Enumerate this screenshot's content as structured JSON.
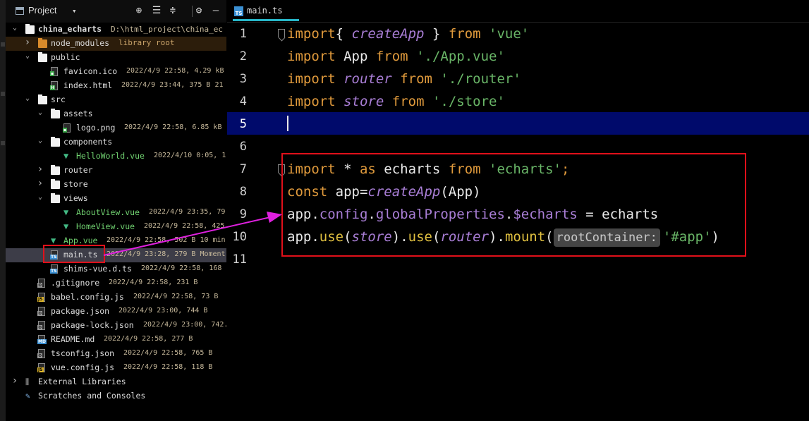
{
  "project_panel": {
    "title": "Project",
    "dropdown_glyph": "▾",
    "toolbar": [
      "target-icon",
      "expand-all-icon",
      "collapse-all-icon",
      "gear-icon",
      "hide-icon"
    ],
    "tree": [
      {
        "depth": 0,
        "chevron": "down",
        "kind": "folder",
        "name": "china_echarts",
        "meta": "D:\\html_project\\china_ec"
      },
      {
        "depth": 1,
        "chevron": "right",
        "kind": "folder-orange",
        "name": "node_modules",
        "meta": "library root"
      },
      {
        "depth": 1,
        "chevron": "down",
        "kind": "folder",
        "name": "public",
        "meta": ""
      },
      {
        "depth": 2,
        "chevron": "",
        "kind": "file-img",
        "name": "favicon.ico",
        "meta": "2022/4/9 22:58, 4.29 kB"
      },
      {
        "depth": 2,
        "chevron": "",
        "kind": "file-h5",
        "name": "index.html",
        "meta": "2022/4/9 23:44, 375 B 21"
      },
      {
        "depth": 1,
        "chevron": "down",
        "kind": "folder",
        "name": "src",
        "meta": ""
      },
      {
        "depth": 2,
        "chevron": "down",
        "kind": "folder",
        "name": "assets",
        "meta": ""
      },
      {
        "depth": 3,
        "chevron": "",
        "kind": "file-img",
        "name": "logo.png",
        "meta": "2022/4/9 22:58, 6.85 kB"
      },
      {
        "depth": 2,
        "chevron": "down",
        "kind": "folder",
        "name": "components",
        "meta": ""
      },
      {
        "depth": 3,
        "chevron": "",
        "kind": "vue",
        "name": "HelloWorld.vue",
        "meta": "2022/4/10 0:05, 1"
      },
      {
        "depth": 2,
        "chevron": "right",
        "kind": "folder",
        "name": "router",
        "meta": ""
      },
      {
        "depth": 2,
        "chevron": "right",
        "kind": "folder",
        "name": "store",
        "meta": ""
      },
      {
        "depth": 2,
        "chevron": "down",
        "kind": "folder",
        "name": "views",
        "meta": ""
      },
      {
        "depth": 3,
        "chevron": "",
        "kind": "vue",
        "name": "AboutView.vue",
        "meta": "2022/4/9 23:35, 79("
      },
      {
        "depth": 3,
        "chevron": "",
        "kind": "vue",
        "name": "HomeView.vue",
        "meta": "2022/4/9 22:58, 425"
      },
      {
        "depth": 2,
        "chevron": "",
        "kind": "vue",
        "name": "App.vue",
        "meta": "2022/4/9 22:58, 502 B 10 min"
      },
      {
        "depth": 2,
        "chevron": "",
        "kind": "file-ts",
        "name": "main.ts",
        "meta": "2022/4/9 23:28, 279 B Moment"
      },
      {
        "depth": 2,
        "chevron": "",
        "kind": "file-ts",
        "name": "shims-vue.d.ts",
        "meta": "2022/4/9 22:58, 168"
      },
      {
        "depth": 1,
        "chevron": "",
        "kind": "file-gear",
        "name": ".gitignore",
        "meta": "2022/4/9 22:58, 231 B"
      },
      {
        "depth": 1,
        "chevron": "",
        "kind": "file-js",
        "name": "babel.config.js",
        "meta": "2022/4/9 22:58, 73 B"
      },
      {
        "depth": 1,
        "chevron": "",
        "kind": "file-gear",
        "name": "package.json",
        "meta": "2022/4/9 23:00, 744 B"
      },
      {
        "depth": 1,
        "chevron": "",
        "kind": "file-gear",
        "name": "package-lock.json",
        "meta": "2022/4/9 23:00, 742."
      },
      {
        "depth": 1,
        "chevron": "",
        "kind": "file-md",
        "name": "README.md",
        "meta": "2022/4/9 22:58, 277 B"
      },
      {
        "depth": 1,
        "chevron": "",
        "kind": "file-gear",
        "name": "tsconfig.json",
        "meta": "2022/4/9 22:58, 765 B"
      },
      {
        "depth": 1,
        "chevron": "",
        "kind": "file-js",
        "name": "vue.config.js",
        "meta": "2022/4/9 22:58, 118 B"
      },
      {
        "depth": 0,
        "chevron": "right",
        "kind": "libs",
        "name": "External Libraries",
        "meta": ""
      },
      {
        "depth": 0,
        "chevron": "",
        "kind": "scratch",
        "name": "Scratches and Consoles",
        "meta": ""
      }
    ],
    "selected_file": "main.ts"
  },
  "editor": {
    "tab_label": "main.ts",
    "tab_icon_label": "TS",
    "current_line": 5,
    "line_numbers": [
      "1",
      "2",
      "3",
      "4",
      "5",
      "6",
      "7",
      "8",
      "9",
      "10",
      "11"
    ],
    "lines": [
      [
        [
          "kw",
          "import"
        ],
        [
          "",
          "{ "
        ],
        [
          "fnit",
          "createApp"
        ],
        [
          "",
          " } "
        ],
        [
          "kw",
          "from"
        ],
        [
          "",
          " "
        ],
        [
          "str",
          "'vue'"
        ]
      ],
      [
        [
          "kw",
          "import"
        ],
        [
          "",
          " App "
        ],
        [
          "kw",
          "from"
        ],
        [
          "",
          " "
        ],
        [
          "str",
          "'./App.vue'"
        ]
      ],
      [
        [
          "kw",
          "import"
        ],
        [
          "",
          " "
        ],
        [
          "fnit",
          "router"
        ],
        [
          "",
          " "
        ],
        [
          "kw",
          "from"
        ],
        [
          "",
          " "
        ],
        [
          "str",
          "'./router'"
        ]
      ],
      [
        [
          "kw",
          "import"
        ],
        [
          "",
          " "
        ],
        [
          "fnit",
          "store"
        ],
        [
          "",
          " "
        ],
        [
          "kw",
          "from"
        ],
        [
          "",
          " "
        ],
        [
          "str",
          "'./store'"
        ]
      ],
      [],
      [],
      [
        [
          "kw",
          "import"
        ],
        [
          "",
          " * "
        ],
        [
          "kw",
          "as"
        ],
        [
          "",
          " echarts "
        ],
        [
          "kw",
          "from"
        ],
        [
          "",
          " "
        ],
        [
          "str",
          "'echarts'"
        ],
        [
          "kw",
          ";"
        ]
      ],
      [
        [
          "kw",
          "const"
        ],
        [
          "",
          " app="
        ],
        [
          "fnit",
          "createApp"
        ],
        [
          "",
          "(App)"
        ]
      ],
      [
        [
          "",
          "app."
        ],
        [
          "prop",
          "config"
        ],
        [
          "",
          "."
        ],
        [
          "prop",
          "globalProperties"
        ],
        [
          "",
          "."
        ],
        [
          "prop",
          "$echarts"
        ],
        [
          "",
          " = echarts"
        ]
      ],
      [
        [
          "",
          "app."
        ],
        [
          "fnc",
          "use"
        ],
        [
          "",
          "("
        ],
        [
          "fnit",
          "store"
        ],
        [
          "",
          ")."
        ],
        [
          "fnc",
          "use"
        ],
        [
          "",
          "("
        ],
        [
          "fnit",
          "router"
        ],
        [
          "",
          ")."
        ],
        [
          "fnc",
          "mount"
        ],
        [
          "",
          "("
        ],
        [
          "hint",
          "rootContainer:"
        ],
        [
          "str",
          "'#app'"
        ],
        [
          "",
          ")"
        ]
      ],
      []
    ]
  },
  "colors": {
    "annotation_red": "#e0101a",
    "arrow_magenta": "#e020e0",
    "current_line_bg": "#000a6b",
    "keyword": "#e09a3c",
    "string": "#69b567",
    "italic_purple": "#a97ed6"
  }
}
